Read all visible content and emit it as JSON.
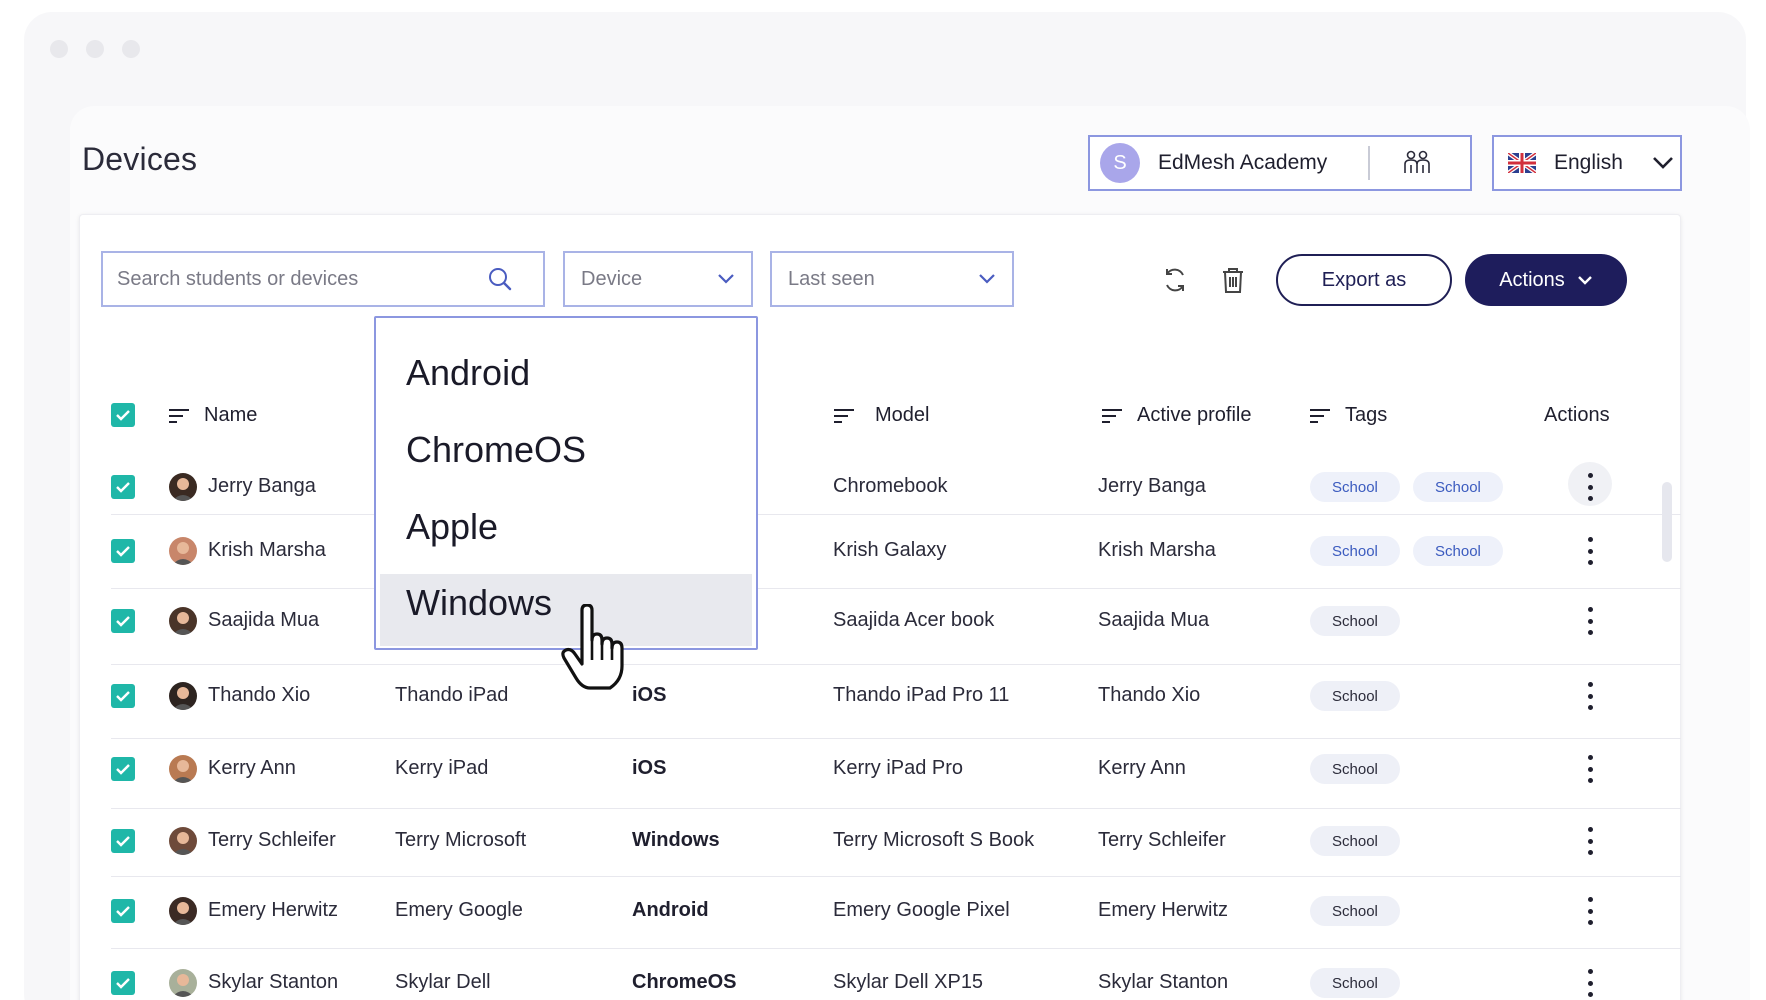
{
  "page": {
    "title": "Devices"
  },
  "org": {
    "avatar_letter": "S",
    "name": "EdMesh Academy",
    "switch_icon": "users-group-icon"
  },
  "language": {
    "label": "English",
    "flag": "uk-flag-icon"
  },
  "toolbar": {
    "search_placeholder": "Search students or devices",
    "device_filter": "Device",
    "lastseen_filter": "Last seen",
    "export_label": "Export as",
    "actions_label": "Actions"
  },
  "device_dropdown": {
    "options": [
      "Android",
      "ChromeOS",
      "Apple",
      "Windows"
    ],
    "highlighted": "Windows"
  },
  "table": {
    "headers": {
      "name": "Name",
      "model": "Model",
      "active_profile": "Active profile",
      "tags": "Tags",
      "actions": "Actions"
    },
    "rows": [
      {
        "name": "Jerry Banga",
        "device": "",
        "os": "",
        "model": "Chromebook",
        "profile": "Jerry Banga",
        "tags": [
          "School",
          "School"
        ]
      },
      {
        "name": "Krish Marsha",
        "device": "",
        "os": "",
        "model": "Krish Galaxy",
        "profile": "Krish Marsha",
        "tags": [
          "School",
          "School"
        ]
      },
      {
        "name": "Saajida Mua",
        "device": "",
        "os": "",
        "model": "Saajida Acer book",
        "profile": "Saajida Mua",
        "tags": [
          "School"
        ]
      },
      {
        "name": "Thando Xio",
        "device": "Thando iPad",
        "os": "iOS",
        "model": "Thando iPad Pro 11",
        "profile": "Thando Xio",
        "tags": [
          "School"
        ]
      },
      {
        "name": "Kerry Ann",
        "device": "Kerry iPad",
        "os": "iOS",
        "model": "Kerry iPad Pro",
        "profile": "Kerry Ann",
        "tags": [
          "School"
        ]
      },
      {
        "name": "Terry Schleifer",
        "device": "Terry Microsoft",
        "os": "Windows",
        "model": "Terry Microsoft S Book",
        "profile": "Terry Schleifer",
        "tags": [
          "School"
        ]
      },
      {
        "name": "Emery Herwitz",
        "device": "Emery Google",
        "os": "Android",
        "model": "Emery Google Pixel",
        "profile": "Emery Herwitz",
        "tags": [
          "School"
        ]
      },
      {
        "name": "Skylar Stanton",
        "device": "Skylar Dell",
        "os": "ChromeOS",
        "model": "Skylar Dell XP15",
        "profile": "Skylar Stanton",
        "tags": [
          "School"
        ]
      }
    ]
  },
  "colors": {
    "accent": "#1e1d5c",
    "checkbox": "#1fb7a8",
    "border": "#8c97e0"
  }
}
